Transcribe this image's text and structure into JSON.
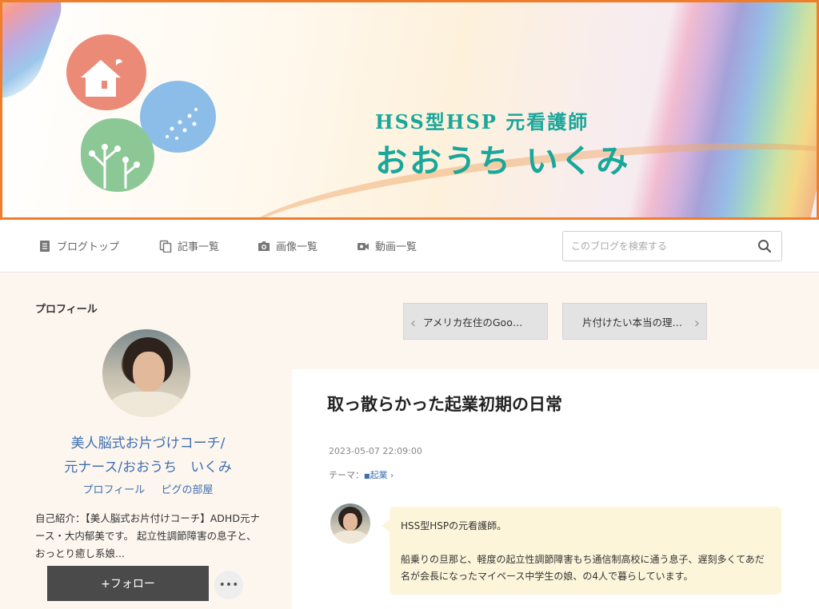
{
  "banner": {
    "subtitle": "HSS型HSP 元看護師",
    "title": "おおうち いくみ"
  },
  "nav": {
    "items": [
      {
        "label": "ブログトップ",
        "icon": "document-icon"
      },
      {
        "label": "記事一覧",
        "icon": "copy-icon"
      },
      {
        "label": "画像一覧",
        "icon": "camera-icon"
      },
      {
        "label": "動画一覧",
        "icon": "video-icon"
      }
    ],
    "search_placeholder": "このブログを検索する"
  },
  "sidebar": {
    "title": "プロフィール",
    "blog_name_line1": "美人脳式お片づけコーチ/",
    "blog_name_line2": "元ナース/おおうち　いくみ",
    "link_profile": "プロフィール",
    "link_room": "ピグの部屋",
    "intro": "自己紹介：【美人脳式お片付けコーチ】ADHD元ナース・大内郁美です。 起立性調節障害の息子と、おっとり癒し系娘...",
    "follow_label": "+フォロー",
    "more_label": "•••"
  },
  "pager": {
    "prev_label": "アメリカ在住のGoo…",
    "next_label": "片付けたい本当の理…"
  },
  "article": {
    "title": "取っ散らかった起業初期の日常",
    "date": "2023-05-07 22:09:00",
    "theme_prefix": "テーマ：",
    "theme": "起業",
    "bubble_p1": "HSS型HSPの元看護師。",
    "bubble_p2": "船乗りの旦那と、軽度の起立性調節障害もち通信制高校に通う息子、遅刻多くてあだ名が会長になったマイペース中学生の娘、の4人で暮らしています。"
  },
  "colors": {
    "banner_border": "#ef7d2b",
    "banner_text": "#1aa79a",
    "link": "#3e6fb0",
    "follow_bg": "#4a4a4a",
    "bubble_bg": "#fdf5da"
  }
}
